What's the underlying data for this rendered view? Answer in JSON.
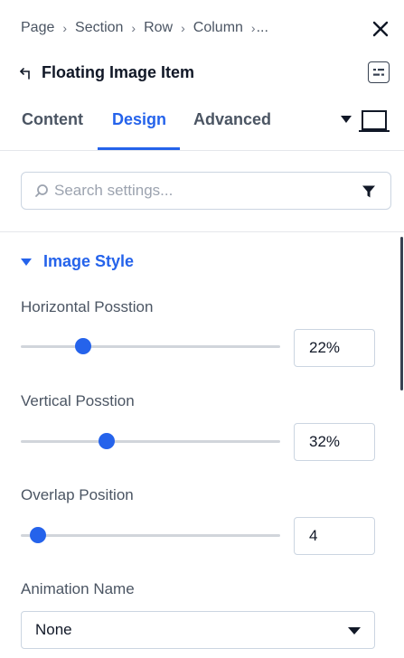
{
  "breadcrumb": {
    "items": [
      "Page",
      "Section",
      "Row",
      "Column"
    ],
    "more": "..."
  },
  "header": {
    "title": "Floating Image Item"
  },
  "tabs": [
    {
      "label": "Content",
      "active": false
    },
    {
      "label": "Design",
      "active": true
    },
    {
      "label": "Advanced",
      "active": false
    }
  ],
  "search": {
    "placeholder": "Search settings...",
    "value": ""
  },
  "section": {
    "title": "Image Style",
    "expanded": true
  },
  "fields": {
    "horizontal": {
      "label": "Horizontal Posstion",
      "value": "22%",
      "slider_fraction": 0.24
    },
    "vertical": {
      "label": "Vertical Posstion",
      "value": "32%",
      "slider_fraction": 0.33
    },
    "overlap": {
      "label": "Overlap Position",
      "value": "4",
      "slider_fraction": 0.065
    },
    "animation": {
      "label": "Animation Name",
      "value": "None"
    }
  },
  "icons": {
    "close": "close-icon",
    "back": "back-arrow-icon",
    "layout": "layout-toggle-icon",
    "device": "desktop-device-icon",
    "search": "search-icon",
    "filter": "filter-icon"
  },
  "colors": {
    "accent": "#2563eb",
    "text": "#4b5563",
    "border": "#cbd5e1"
  }
}
